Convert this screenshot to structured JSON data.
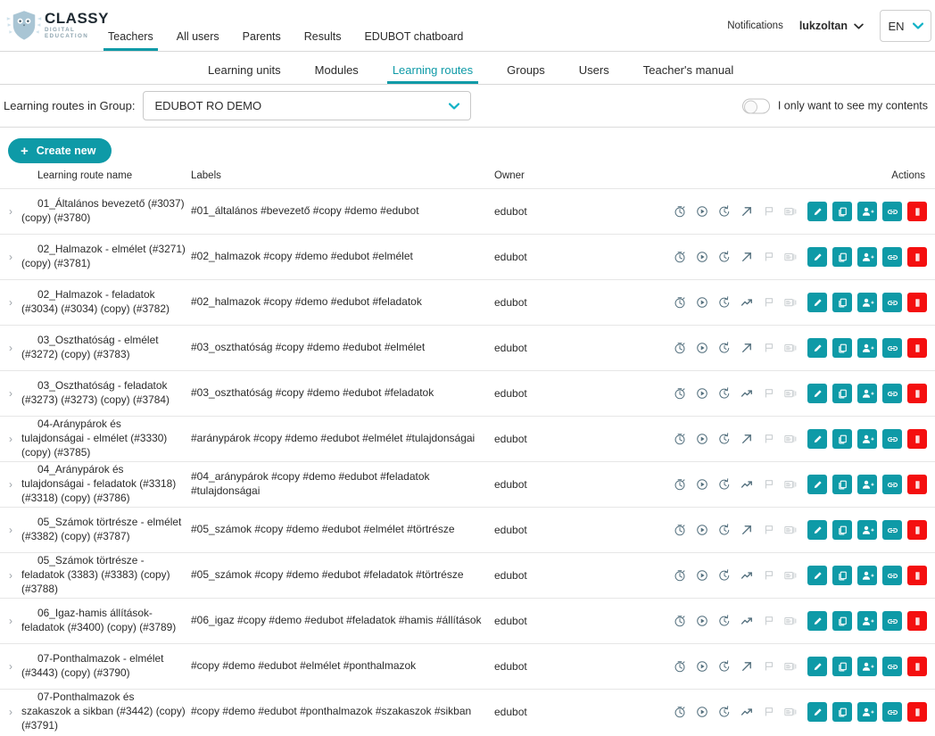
{
  "brand": {
    "name": "CLASSY",
    "tagline": "DIGITAL EDUCATION",
    "accent": "#0e9aa7",
    "danger": "#f40f0f",
    "logo_color": "#a9c5d4"
  },
  "header": {
    "nav": [
      {
        "label": "Teachers",
        "active": true
      },
      {
        "label": "All users",
        "active": false
      },
      {
        "label": "Parents",
        "active": false
      },
      {
        "label": "Results",
        "active": false
      },
      {
        "label": "EDUBOT chatboard",
        "active": false
      }
    ],
    "notifications_label": "Notifications",
    "user_name": "lukzoltan",
    "language": "EN"
  },
  "subnav": [
    {
      "label": "Learning units",
      "active": false
    },
    {
      "label": "Modules",
      "active": false
    },
    {
      "label": "Learning routes",
      "active": true
    },
    {
      "label": "Groups",
      "active": false
    },
    {
      "label": "Users",
      "active": false
    },
    {
      "label": "Teacher's manual",
      "active": false
    }
  ],
  "filter": {
    "label": "Learning routes in Group:",
    "group_value": "EDUBOT RO DEMO",
    "toggle_label": "I only want to see my contents",
    "toggle_on": false
  },
  "toolbar": {
    "create_label": "Create new",
    "plus": "+"
  },
  "table": {
    "columns": {
      "name": "Learning route name",
      "labels": "Labels",
      "owner": "Owner",
      "actions": "Actions"
    },
    "expand_glyph": "›",
    "row_icons": [
      "timer-icon",
      "play-circle-icon",
      "history-icon",
      "trend-icon",
      "flag-icon",
      "flashcard-icon"
    ],
    "row_buttons": [
      "edit-icon",
      "duplicate-icon",
      "add-user-icon",
      "link-icon",
      "delete-icon"
    ],
    "rows": [
      {
        "name": "01_Általános bevezető (#3037) (copy) (#3780)",
        "labels": "#01_általános #bevezető #copy #demo #edubot",
        "owner": "edubot",
        "trend": "diagonal"
      },
      {
        "name": "02_Halmazok - elmélet (#3271) (copy) (#3781)",
        "labels": "#02_halmazok #copy #demo #edubot #elmélet",
        "owner": "edubot",
        "trend": "diagonal"
      },
      {
        "name": "02_Halmazok - feladatok (#3034) (#3034) (copy) (#3782)",
        "labels": "#02_halmazok #copy #demo #edubot #feladatok",
        "owner": "edubot",
        "trend": "zigzag"
      },
      {
        "name": "03_Oszthatóság - elmélet (#3272) (copy) (#3783)",
        "labels": "#03_oszthatóság #copy #demo #edubot #elmélet",
        "owner": "edubot",
        "trend": "diagonal"
      },
      {
        "name": "03_Oszthatóság - feladatok (#3273) (#3273) (copy) (#3784)",
        "labels": "#03_oszthatóság #copy #demo #edubot #feladatok",
        "owner": "edubot",
        "trend": "zigzag"
      },
      {
        "name": "04-Aránypárok és tulajdonságai - elmélet (#3330) (copy) (#3785)",
        "labels": "#aránypárok #copy #demo #edubot #elmélet #tulajdonságai",
        "owner": "edubot",
        "trend": "diagonal"
      },
      {
        "name": "04_Aránypárok és tulajdonságai - feladatok (#3318) (#3318) (copy) (#3786)",
        "labels": "#04_aránypárok #copy #demo #edubot #feladatok #tulajdonságai",
        "owner": "edubot",
        "trend": "zigzag"
      },
      {
        "name": "05_Számok törtrésze - elmélet (#3382) (copy) (#3787)",
        "labels": "#05_számok #copy #demo #edubot #elmélet #törtrésze",
        "owner": "edubot",
        "trend": "diagonal"
      },
      {
        "name": "05_Számok törtrésze - feladatok (3383) (#3383) (copy) (#3788)",
        "labels": "#05_számok #copy #demo #edubot #feladatok #törtrésze",
        "owner": "edubot",
        "trend": "zigzag"
      },
      {
        "name": "06_Igaz-hamis állítások-feladatok (#3400) (copy) (#3789)",
        "labels": "#06_igaz #copy #demo #edubot #feladatok #hamis #állítások",
        "owner": "edubot",
        "trend": "zigzag"
      },
      {
        "name": "07-Ponthalmazok - elmélet (#3443) (copy) (#3790)",
        "labels": "#copy #demo #edubot #elmélet #ponthalmazok",
        "owner": "edubot",
        "trend": "diagonal"
      },
      {
        "name": "07-Ponthalmazok és szakaszok a sikban (#3442) (copy) (#3791)",
        "labels": "#copy #demo #edubot #ponthalmazok #szakaszok #sikban",
        "owner": "edubot",
        "trend": "zigzag"
      }
    ]
  }
}
